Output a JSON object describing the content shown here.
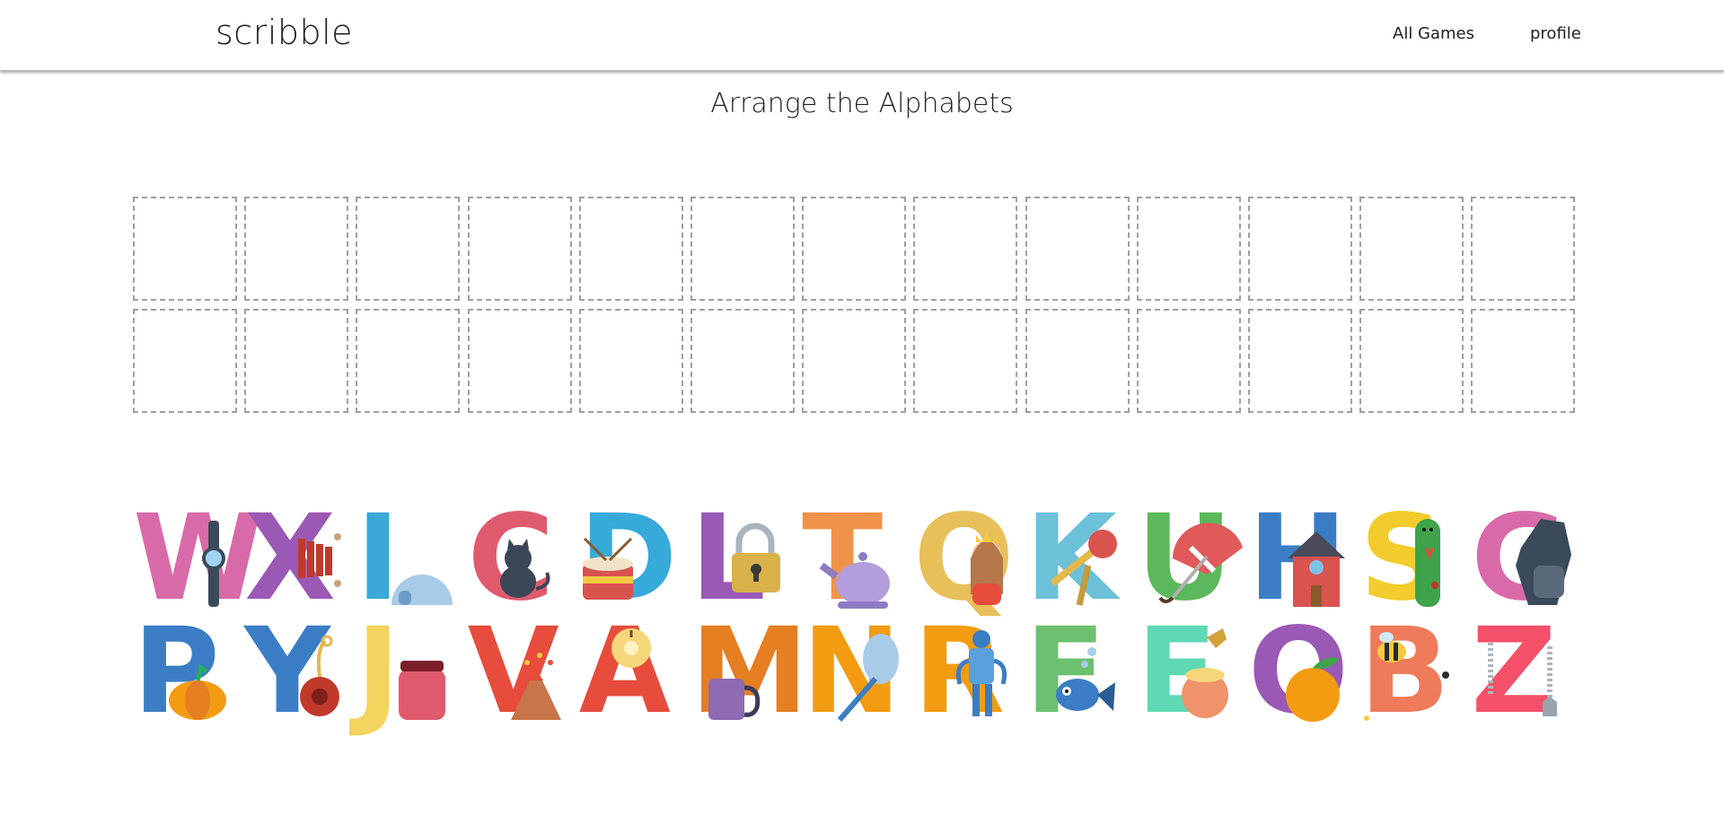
{
  "header": {
    "brand": "scribble",
    "nav": [
      {
        "label": "All Games"
      },
      {
        "label": "profile"
      }
    ]
  },
  "main": {
    "title": "Arrange the Alphabets",
    "empty_slots": 26,
    "tiles": [
      {
        "letter": "W",
        "color": "#d96aa9",
        "icon": "wristwatch-icon"
      },
      {
        "letter": "X",
        "color": "#9b59b6",
        "icon": "xylophone-icon"
      },
      {
        "letter": "I",
        "color": "#3aa8d8",
        "icon": "igloo-icon"
      },
      {
        "letter": "C",
        "color": "#e05a6e",
        "icon": "cat-icon"
      },
      {
        "letter": "D",
        "color": "#36aad9",
        "icon": "drum-icon"
      },
      {
        "letter": "L",
        "color": "#9b59b6",
        "icon": "padlock-icon"
      },
      {
        "letter": "T",
        "color": "#f0934a",
        "icon": "teapot-icon"
      },
      {
        "letter": "Q",
        "color": "#e8c05a",
        "icon": "queen-icon"
      },
      {
        "letter": "K",
        "color": "#6cc1d8",
        "icon": "key-icon"
      },
      {
        "letter": "U",
        "color": "#5cb85c",
        "icon": "umbrella-icon"
      },
      {
        "letter": "H",
        "color": "#3b7dc4",
        "icon": "house-icon"
      },
      {
        "letter": "S",
        "color": "#f2cc2c",
        "icon": "snake-icon"
      },
      {
        "letter": "G",
        "color": "#d96aa9",
        "icon": "glove-icon"
      },
      {
        "letter": "P",
        "color": "#3b7dc4",
        "icon": "pumpkin-icon"
      },
      {
        "letter": "Y",
        "color": "#3b7dc4",
        "icon": "yoyo-icon"
      },
      {
        "letter": "J",
        "color": "#f4d35e",
        "icon": "jam-jar-icon"
      },
      {
        "letter": "V",
        "color": "#e74c3c",
        "icon": "volcano-icon"
      },
      {
        "letter": "A",
        "color": "#e74c3c",
        "icon": "apple-icon"
      },
      {
        "letter": "M",
        "color": "#e67e22",
        "icon": "mug-icon"
      },
      {
        "letter": "N",
        "color": "#f39c12",
        "icon": "net-icon"
      },
      {
        "letter": "R",
        "color": "#f39c12",
        "icon": "robot-icon"
      },
      {
        "letter": "F",
        "color": "#6cc070",
        "icon": "fish-icon"
      },
      {
        "letter": "E",
        "color": "#5fd9b5",
        "icon": "honey-pot-icon"
      },
      {
        "letter": "O",
        "color": "#9b59b6",
        "icon": "orange-icon"
      },
      {
        "letter": "B",
        "color": "#f07b5a",
        "icon": "bee-icon"
      },
      {
        "letter": "Z",
        "color": "#f4506a",
        "icon": "zipper-icon"
      }
    ]
  },
  "colors": {
    "slot_border": "#a0a0a0",
    "background": "#ffffff",
    "text": "#222222"
  }
}
